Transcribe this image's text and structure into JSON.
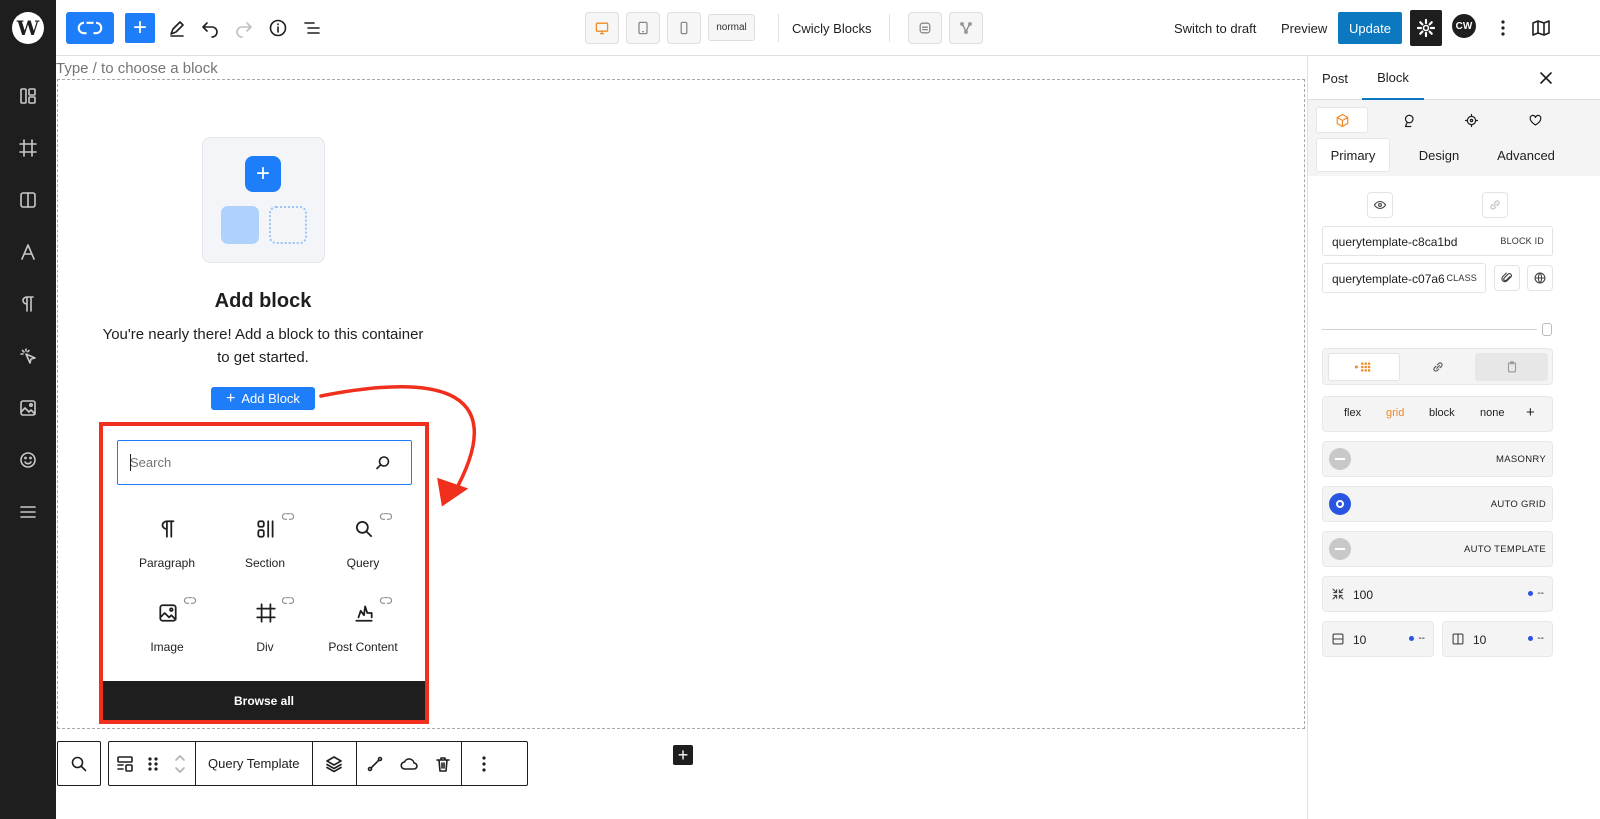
{
  "admin_sidebar": {
    "logo": "wordpress-logo",
    "items": [
      "layout-icon",
      "grid-frame-icon",
      "columns-icon",
      "typography-icon",
      "pilcrow-icon",
      "cursor-click-icon",
      "image-icon",
      "smiley-icon",
      "menu-lines-icon"
    ]
  },
  "toolbar": {
    "logo": "cwicly-logo",
    "inserter_symbol": "+",
    "device_state": "normal",
    "brand_label": "Cwicly Blocks",
    "switch_to_draft": "Switch to draft",
    "preview": "Preview",
    "update": "Update",
    "avatar_text": "CW",
    "accent": "#1e7df8",
    "update_color": "#0b78bf"
  },
  "canvas": {
    "type_hint": "Type / to choose a block",
    "placeholder_title": "Add block",
    "placeholder_desc": "You're nearly there! Add a block to this container to get started.",
    "add_block_label": "Add Block",
    "add_block_symbol": "+",
    "container_add_symbol": "+",
    "annotation_color": "#f0301c"
  },
  "inserter": {
    "search_placeholder": "Search",
    "blocks": [
      {
        "label": "Paragraph",
        "icon": "pilcrow-icon"
      },
      {
        "label": "Section",
        "icon": "section-icon"
      },
      {
        "label": "Query",
        "icon": "query-search-icon"
      },
      {
        "label": "Image",
        "icon": "image-icon"
      },
      {
        "label": "Div",
        "icon": "div-frame-icon"
      },
      {
        "label": "Post Content",
        "icon": "post-content-icon"
      }
    ],
    "browse_all": "Browse all"
  },
  "block_toolbar": {
    "block_name": "Query Template"
  },
  "sidebar": {
    "tabs": {
      "post": "Post",
      "block": "Block"
    },
    "panel_tabs": {
      "primary": "Primary",
      "design": "Design",
      "advanced": "Advanced"
    },
    "block_id_value": "querytemplate-c8ca1bd",
    "block_id_label": "BLOCK ID",
    "class_value": "querytemplate-c07a6",
    "class_label": "CLASS",
    "display_options": [
      "flex",
      "grid",
      "block",
      "none"
    ],
    "display_add": "+",
    "active_display": "grid",
    "grid_modes": [
      {
        "label": "MASONRY",
        "selected": false
      },
      {
        "label": "AUTO GRID",
        "selected": true
      },
      {
        "label": "AUTO TEMPLATE",
        "selected": false
      }
    ],
    "min_width": {
      "value": "100",
      "unit": "--"
    },
    "row_gap": {
      "value": "10",
      "unit": "--"
    },
    "column_gap": {
      "value": "10",
      "unit": "--"
    }
  }
}
